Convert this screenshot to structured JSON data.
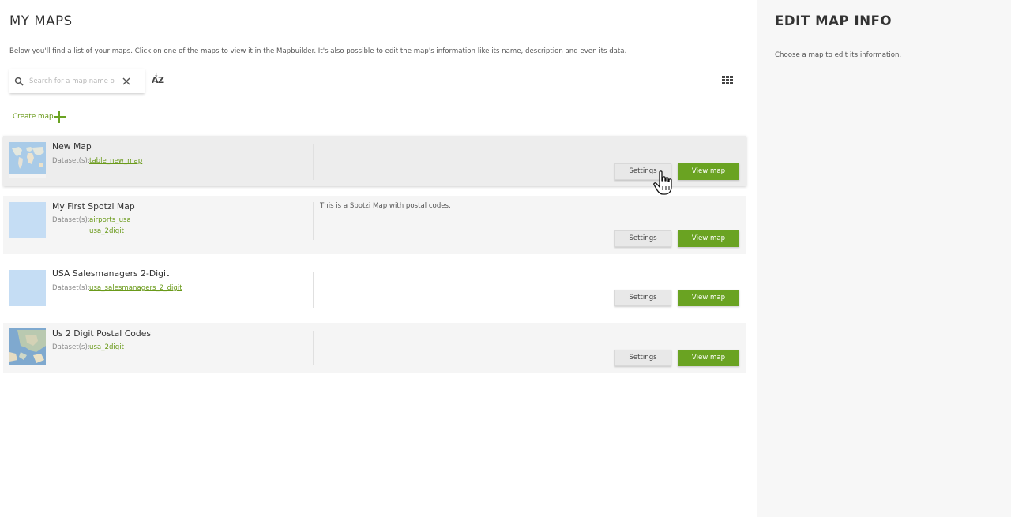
{
  "main": {
    "title": "MY MAPS",
    "intro": "Below you'll find a list of your maps. Click on one of the maps to view it in the Mapbuilder. It's also possible to edit the map's information like its name, description and even its data.",
    "search": {
      "placeholder": "Search for a map name o",
      "value": ""
    },
    "sort_label": "AZ",
    "create_label": "Create map"
  },
  "maps": [
    {
      "name": "New Map",
      "datasets_label": "Dataset(s):",
      "datasets": [
        "table_new_map"
      ],
      "description": "",
      "settings_label": "Settings",
      "view_label": "View map",
      "thumbnail": "world-map"
    },
    {
      "name": "My First Spotzi Map",
      "datasets_label": "Dataset(s):",
      "datasets": [
        "airports_usa",
        "usa_2digit"
      ],
      "description": "This is a Spotzi Map with postal codes.",
      "settings_label": "Settings",
      "view_label": "View map",
      "thumbnail": "blank-blue"
    },
    {
      "name": "USA Salesmanagers 2-Digit",
      "datasets_label": "Dataset(s):",
      "datasets": [
        "usa_salesmanagers_2_digit"
      ],
      "description": "",
      "settings_label": "Settings",
      "view_label": "View map",
      "thumbnail": "blank-blue"
    },
    {
      "name": "Us 2 Digit Postal Codes",
      "datasets_label": "Dataset(s):",
      "datasets": [
        "usa_2digit"
      ],
      "description": "",
      "settings_label": "Settings",
      "view_label": "View map",
      "thumbnail": "usa-map"
    }
  ],
  "side": {
    "title": "EDIT MAP INFO",
    "hint": "Choose a map to edit its information."
  },
  "colors": {
    "accent": "#6aa322",
    "link": "#6a9a1a",
    "card": "#f5f5f5",
    "panel": "#f7f7f7"
  },
  "icons": [
    "search-icon",
    "clear-icon",
    "sort-az-icon",
    "grid-view-icon",
    "plus-icon",
    "hand-cursor-icon"
  ]
}
